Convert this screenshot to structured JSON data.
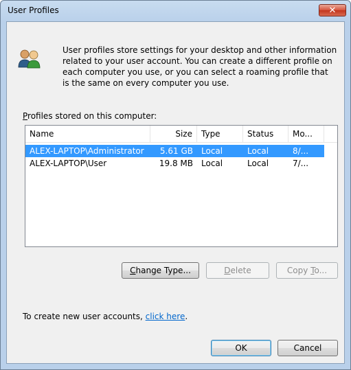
{
  "window": {
    "title": "User Profiles",
    "close_symbol": "✕"
  },
  "intro": {
    "text": "User profiles store settings for your desktop and other information related to your user account. You can create a different profile on each computer you use, or you can select a roaming profile that is the same on every computer you use."
  },
  "profiles": {
    "label_prefix": "P",
    "label_rest": "rofiles stored on this computer:",
    "columns": [
      "Name",
      "Size",
      "Type",
      "Status",
      "Mo..."
    ],
    "rows": [
      {
        "name": "ALEX-LAPTOP\\Administrator",
        "size": "5.61 GB",
        "type": "Local",
        "status": "Local",
        "modified": "8/...",
        "selected": true
      },
      {
        "name": "ALEX-LAPTOP\\User",
        "size": "19.8 MB",
        "type": "Local",
        "status": "Local",
        "modified": "7/...",
        "selected": false
      }
    ]
  },
  "buttons": {
    "change_type_u": "C",
    "change_type_rest": "hange Type...",
    "delete_u": "D",
    "delete_rest": "elete",
    "copy_to_pre": "Copy ",
    "copy_to_u": "T",
    "copy_to_rest": "o...",
    "ok": "OK",
    "cancel": "Cancel"
  },
  "create": {
    "text": "To create new user accounts, ",
    "link": "click here",
    "suffix": "."
  },
  "colors": {
    "selection": "#3399ff",
    "link": "#0066cc",
    "dialog_bg": "#f0f0f0"
  }
}
